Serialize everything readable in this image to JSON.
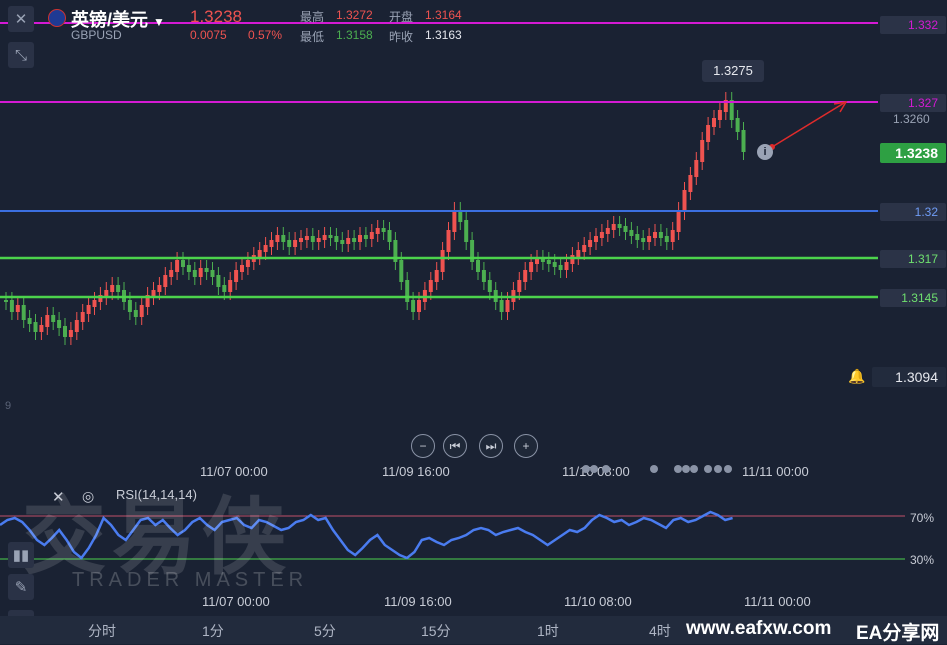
{
  "header": {
    "pair_name": "英镑/美元",
    "symbol": "GBPUSD",
    "last_price": "1.3238",
    "change": "0.0075",
    "change_pct": "0.57%",
    "high_label": "最高",
    "high_value": "1.3272",
    "open_label": "开盘",
    "open_value": "1.3164",
    "low_label": "最低",
    "low_value": "1.3158",
    "prev_close_label": "昨收",
    "prev_close_value": "1.3163"
  },
  "horizontal_lines": [
    {
      "label": "1.332",
      "color": "#d41ad4"
    },
    {
      "label": "1.327",
      "color": "#d41ad4"
    },
    {
      "label": "1.32",
      "color": "#3b6fe0"
    },
    {
      "label": "1.317",
      "color": "#4cd34c"
    },
    {
      "label": "1.3145",
      "color": "#4cd34c"
    }
  ],
  "axis_price_1": "1.3260",
  "current_price_tag": "1.3238",
  "alert_price": "1.3094",
  "peak_tooltip": "1.3275",
  "info_marker": "i",
  "stray_label": "9",
  "nav_buttons": [
    "−",
    "⏮",
    "⏭",
    "+"
  ],
  "time_axis": [
    "11/07 00:00",
    "11/09 16:00",
    "11/10 08:00",
    "11/11 00:00"
  ],
  "rsi": {
    "label": "RSI(14,14,14)",
    "levels": [
      "70%",
      "30%"
    ],
    "time_axis": [
      "11/07 00:00",
      "11/09 16:00",
      "11/10 08:00",
      "11/11 00:00"
    ]
  },
  "watermark": {
    "main": "交易侠",
    "sub": "TRADER MASTER"
  },
  "timeframes": [
    "分时",
    "1分",
    "5分",
    "15分",
    "1时",
    "4时"
  ],
  "site_credit": "www.eafxw.com",
  "site_brand": "EA分享网",
  "colors": {
    "up": "#ef5350",
    "down": "#4caf50",
    "rsi": "#4a7cf0",
    "bg": "#1a2233"
  }
}
